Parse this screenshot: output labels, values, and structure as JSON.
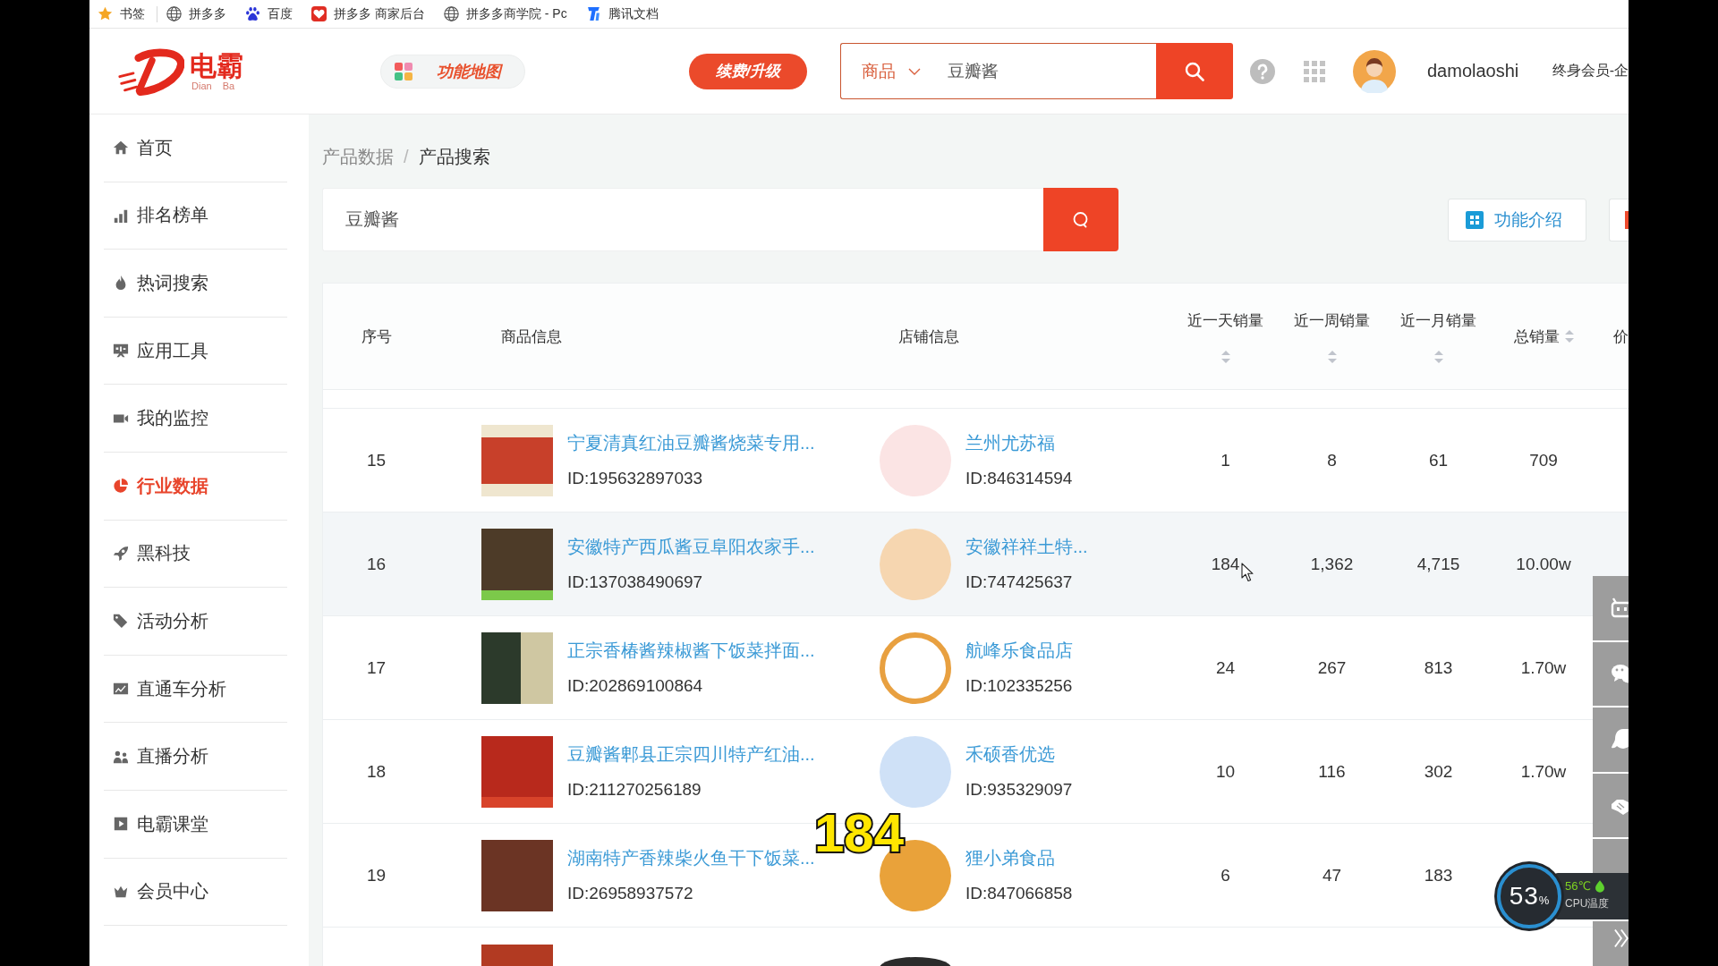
{
  "bookmarks_bar": {
    "items": [
      {
        "label": "书签"
      },
      {
        "label": "拼多多"
      },
      {
        "label": "百度"
      },
      {
        "label": "拼多多 商家后台"
      },
      {
        "label": "拼多多商学院 - Pc"
      },
      {
        "label": "腾讯文档"
      }
    ]
  },
  "header": {
    "logo": {
      "name": "电霸",
      "romanization": [
        "Dian",
        "Ba"
      ]
    },
    "feature_map_button": "功能地图",
    "renew_button": "续费/升级",
    "search": {
      "category": "商品",
      "value": "豆瓣酱"
    },
    "username": "damolaoshi",
    "membership": "终身会员-企"
  },
  "sidebar": {
    "items": [
      {
        "label": "首页",
        "selected": false
      },
      {
        "label": "排名榜单",
        "selected": false
      },
      {
        "label": "热词搜索",
        "selected": false
      },
      {
        "label": "应用工具",
        "selected": false
      },
      {
        "label": "我的监控",
        "selected": false
      },
      {
        "label": "行业数据",
        "selected": true
      },
      {
        "label": "黑科技",
        "selected": false
      },
      {
        "label": "活动分析",
        "selected": false
      },
      {
        "label": "直通车分析",
        "selected": false
      },
      {
        "label": "直播分析",
        "selected": false
      },
      {
        "label": "电霸课堂",
        "selected": false
      },
      {
        "label": "会员中心",
        "selected": false
      }
    ]
  },
  "breadcrumb": {
    "items": [
      "产品数据",
      "产品搜索"
    ],
    "separator": "/"
  },
  "search_panel": {
    "value": "豆瓣酱",
    "intro_button": "功能介绍",
    "cut_button": true
  },
  "table": {
    "columns": [
      {
        "label": "序号",
        "sortable": false
      },
      {
        "label": "商品信息",
        "sortable": false
      },
      {
        "label": "店铺信息",
        "sortable": false
      },
      {
        "label": "近一天销量",
        "sortable": true
      },
      {
        "label": "近一周销量",
        "sortable": true
      },
      {
        "label": "近一月销量",
        "sortable": true
      },
      {
        "label": "总销量",
        "sortable": true
      },
      {
        "label": "价",
        "sortable": false
      }
    ],
    "rows": [
      {
        "index": "15",
        "product_title": "宁夏清真红油豆瓣酱烧菜专用...",
        "product_id": "ID:195632897033",
        "shop_name": "兰州尤苏福",
        "shop_id": "ID:846314594",
        "sales": [
          "1",
          "8",
          "61",
          "709"
        ],
        "highlighted": false
      },
      {
        "index": "16",
        "product_title": "安徽特产西瓜酱豆阜阳农家手...",
        "product_id": "ID:137038490697",
        "shop_name": "安徽祥祥土特...",
        "shop_id": "ID:747425637",
        "sales": [
          "184",
          "1,362",
          "4,715",
          "10.00w"
        ],
        "highlighted": true
      },
      {
        "index": "17",
        "product_title": "正宗香椿酱辣椒酱下饭菜拌面...",
        "product_id": "ID:202869100864",
        "shop_name": "航峰乐食品店",
        "shop_id": "ID:102335256",
        "sales": [
          "24",
          "267",
          "813",
          "1.70w"
        ],
        "highlighted": false
      },
      {
        "index": "18",
        "product_title": "豆瓣酱郫县正宗四川特产红油...",
        "product_id": "ID:211270256189",
        "shop_name": "禾硕香优选",
        "shop_id": "ID:935329097",
        "sales": [
          "10",
          "116",
          "302",
          "1.70w"
        ],
        "highlighted": false
      },
      {
        "index": "19",
        "product_title": "湖南特产香辣柴火鱼干下饭菜...",
        "product_id": "ID:26958937572",
        "shop_name": "狸小弟食品",
        "shop_id": "ID:847066858",
        "sales": [
          "6",
          "47",
          "183"
        ],
        "highlighted": false
      }
    ],
    "more_rows_below": true
  },
  "cpu_widget": {
    "usage": "53",
    "unit": "%",
    "temperature": "56℃",
    "label": "CPU温度"
  },
  "caption": "184"
}
